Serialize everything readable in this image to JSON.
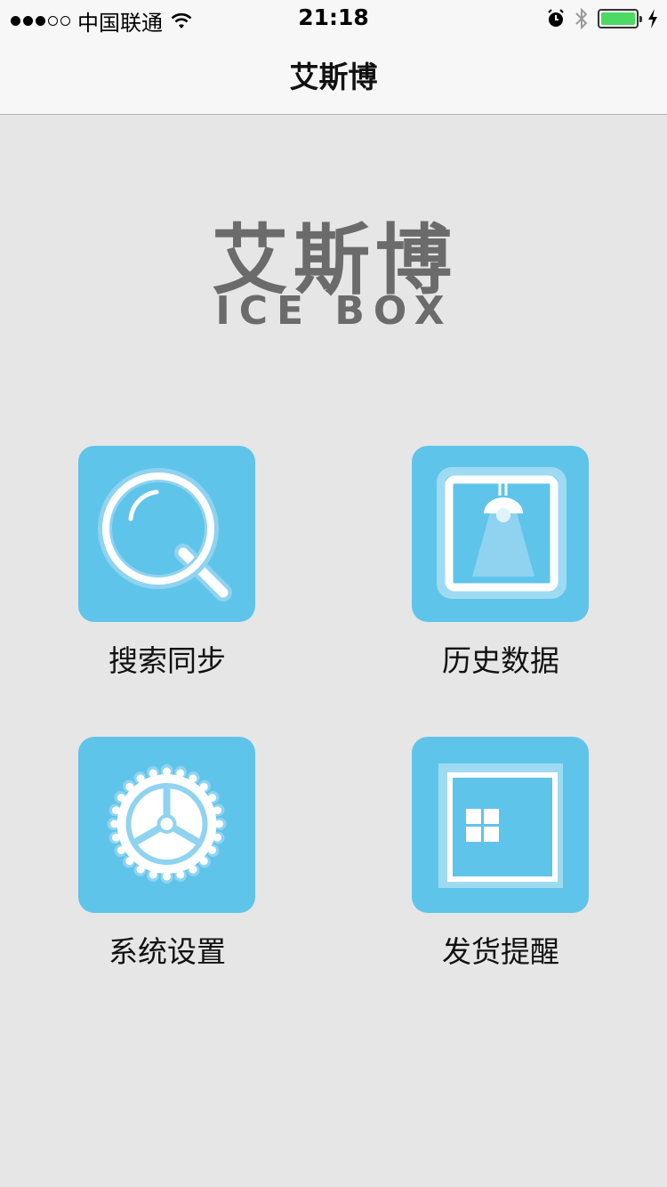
{
  "status_bar": {
    "carrier": "中国联通",
    "time": "21:18",
    "battery_level": 1.0
  },
  "nav": {
    "title": "艾斯博"
  },
  "logo": {
    "chinese": "艾斯博",
    "english": "ICE BOX"
  },
  "menu": [
    {
      "label": "搜索同步",
      "icon": "magnifier-icon"
    },
    {
      "label": "历史数据",
      "icon": "lamp-frame-icon"
    },
    {
      "label": "系统设置",
      "icon": "gear-icon"
    },
    {
      "label": "发货提醒",
      "icon": "window-frame-icon"
    }
  ],
  "colors": {
    "tile": "#5fc4ea",
    "background": "#e6e6e6",
    "battery": "#4cd964"
  }
}
